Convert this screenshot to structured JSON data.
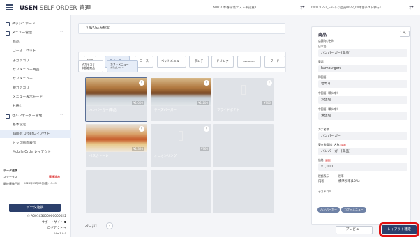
{
  "header": {
    "app_name": "USEN",
    "app_suffix": "SELF ORDER 管理",
    "store": "A001C本番環境テスト表記重1",
    "terminal": "0001:TEST_EAT-レジ会員0072_00本番テスト移行1"
  },
  "sidebar": {
    "items": [
      "ダッシュボード",
      "メニュー管理",
      "商品",
      "コース・セット",
      "子カテゴリ",
      "サブメニュー商品",
      "サブメニュー",
      "親カテゴリ",
      "メニュー表示モード",
      "お通し",
      "セルフオーダー管理",
      "基本設定",
      "Tablet Orderレイアウト",
      "トップ画面表示",
      "Mobile Orderレイアウト"
    ],
    "status_title": "データ連携",
    "status_label": "ステータス",
    "status_value": "連携済み",
    "last_sync_label": "最終連携日時",
    "last_sync_value": "2023年03月03日(金) 13:49",
    "sync_button": "データ連携",
    "user_id": "A001C3000000000022",
    "support": "サポートサイト",
    "logout": "ログアウト",
    "version": "Ver.1.0.0"
  },
  "main": {
    "filter_label": "絞り込み検索",
    "tabs": [
      "料理",
      "★テイクアウト",
      "コース",
      "ペットメニュー",
      "ランチ",
      "ドリンク",
      "ALL MENU",
      "フード"
    ],
    "subtabs": [
      {
        "l1": "子カテゴリ",
        "l2": "未設定商品"
      },
      {
        "l1": "カフェメニュー",
        "l2": "カテゴリ4/1〜"
      }
    ],
    "cards": [
      {
        "name": "ハンバーガー(単品)",
        "price": "¥1,000",
        "img": "burger"
      },
      {
        "name": "チーズバーガー",
        "price": "¥1,200",
        "img": "burger"
      },
      {
        "name": "フライドポテト",
        "price": "¥700",
        "img": ""
      },
      {
        "name": "ペスカトーレ",
        "price": "¥1,320",
        "img": "pasta"
      },
      {
        "name": "オニオンリング",
        "price": "¥760",
        "img": ""
      }
    ],
    "page": "ページ1"
  },
  "panel": {
    "title": "商品",
    "fields": [
      {
        "label": "店舗向け名称",
        "value": ""
      },
      {
        "label": "日本語",
        "value": "ハンバーガー(単品)"
      },
      {
        "label": "英語",
        "value": "hamburgers"
      },
      {
        "label": "韓国語",
        "value": "햄버거"
      },
      {
        "label": "中国語（簡体字）",
        "value": "汉堡包"
      },
      {
        "label": "中国語（繁体字）",
        "value": "漢堡包"
      },
      {
        "label": "カナ名称",
        "value": "ハンバーガー"
      },
      {
        "label": "東京書籍向け名称",
        "value": "ハンバーガー(単品)"
      },
      {
        "label": "価格",
        "value": "¥1,000"
      }
    ],
    "tax_label": "税額表示",
    "tax_value": "税率",
    "tax_type": "内税",
    "tax_rate": "標準税率(10%)",
    "child_label": "子カテゴリ",
    "chips": [
      "ハンバーガー",
      "カフェメニュー"
    ],
    "required": "必須"
  },
  "footer": {
    "preview": "プレビュー",
    "confirm": "レイアウト確定"
  }
}
